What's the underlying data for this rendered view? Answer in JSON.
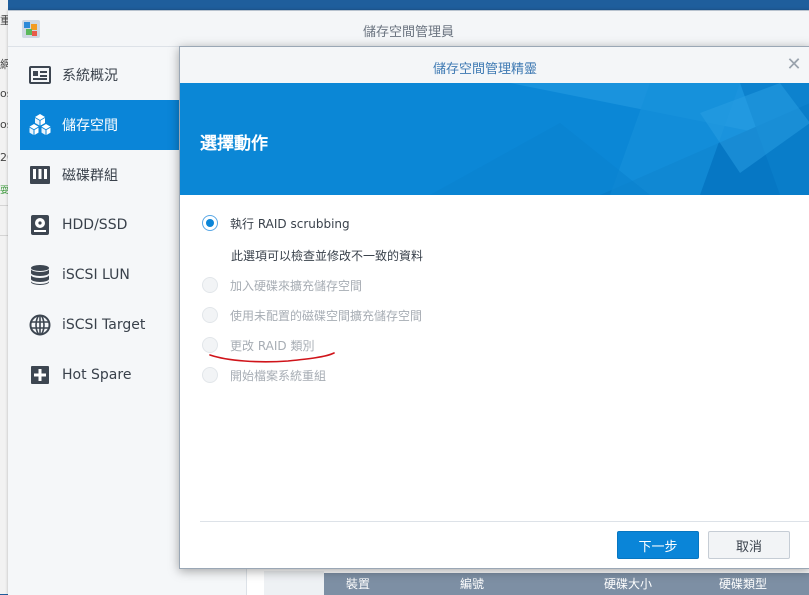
{
  "background": {
    "left_fragments": [
      "重",
      "網",
      "os",
      "os",
      "20",
      "耍"
    ]
  },
  "window": {
    "title": "儲存空間管理員",
    "logo_icon": "storage-manager-logo-icon"
  },
  "sidebar": {
    "items": [
      {
        "label": "系統概況",
        "icon": "overview-icon",
        "active": false
      },
      {
        "label": "儲存空間",
        "icon": "storage-cubes-icon",
        "active": true
      },
      {
        "label": "磁碟群組",
        "icon": "disk-group-icon",
        "active": false
      },
      {
        "label": "HDD/SSD",
        "icon": "hdd-icon",
        "active": false
      },
      {
        "label": "iSCSI LUN",
        "icon": "iscsi-lun-icon",
        "active": false
      },
      {
        "label": "iSCSI Target",
        "icon": "globe-icon",
        "active": false
      },
      {
        "label": "Hot Spare",
        "icon": "plus-square-icon",
        "active": false
      }
    ]
  },
  "grid": {
    "columns": [
      "裝置",
      "編號",
      "硬碟大小",
      "硬碟類型"
    ]
  },
  "dialog": {
    "title": "儲存空間管理精靈",
    "close_icon": "close-icon",
    "banner_title": "選擇動作",
    "options": [
      {
        "label": "執行 RAID scrubbing",
        "selected": true,
        "enabled": true
      },
      {
        "label": "加入硬碟來擴充儲存空間",
        "selected": false,
        "enabled": false
      },
      {
        "label": "使用未配置的磁碟空間擴充儲存空間",
        "selected": false,
        "enabled": false
      },
      {
        "label": "更改 RAID 類別",
        "selected": false,
        "enabled": false
      },
      {
        "label": "開始檔案系統重組",
        "selected": false,
        "enabled": false
      }
    ],
    "option_description": "此選項可以檢查並修改不一致的資料",
    "next_button": "下一步",
    "cancel_button": "取消"
  },
  "colors": {
    "accent": "#0a85d8",
    "banner": "#0b87d6",
    "annotation_underline": "#d0141a"
  }
}
